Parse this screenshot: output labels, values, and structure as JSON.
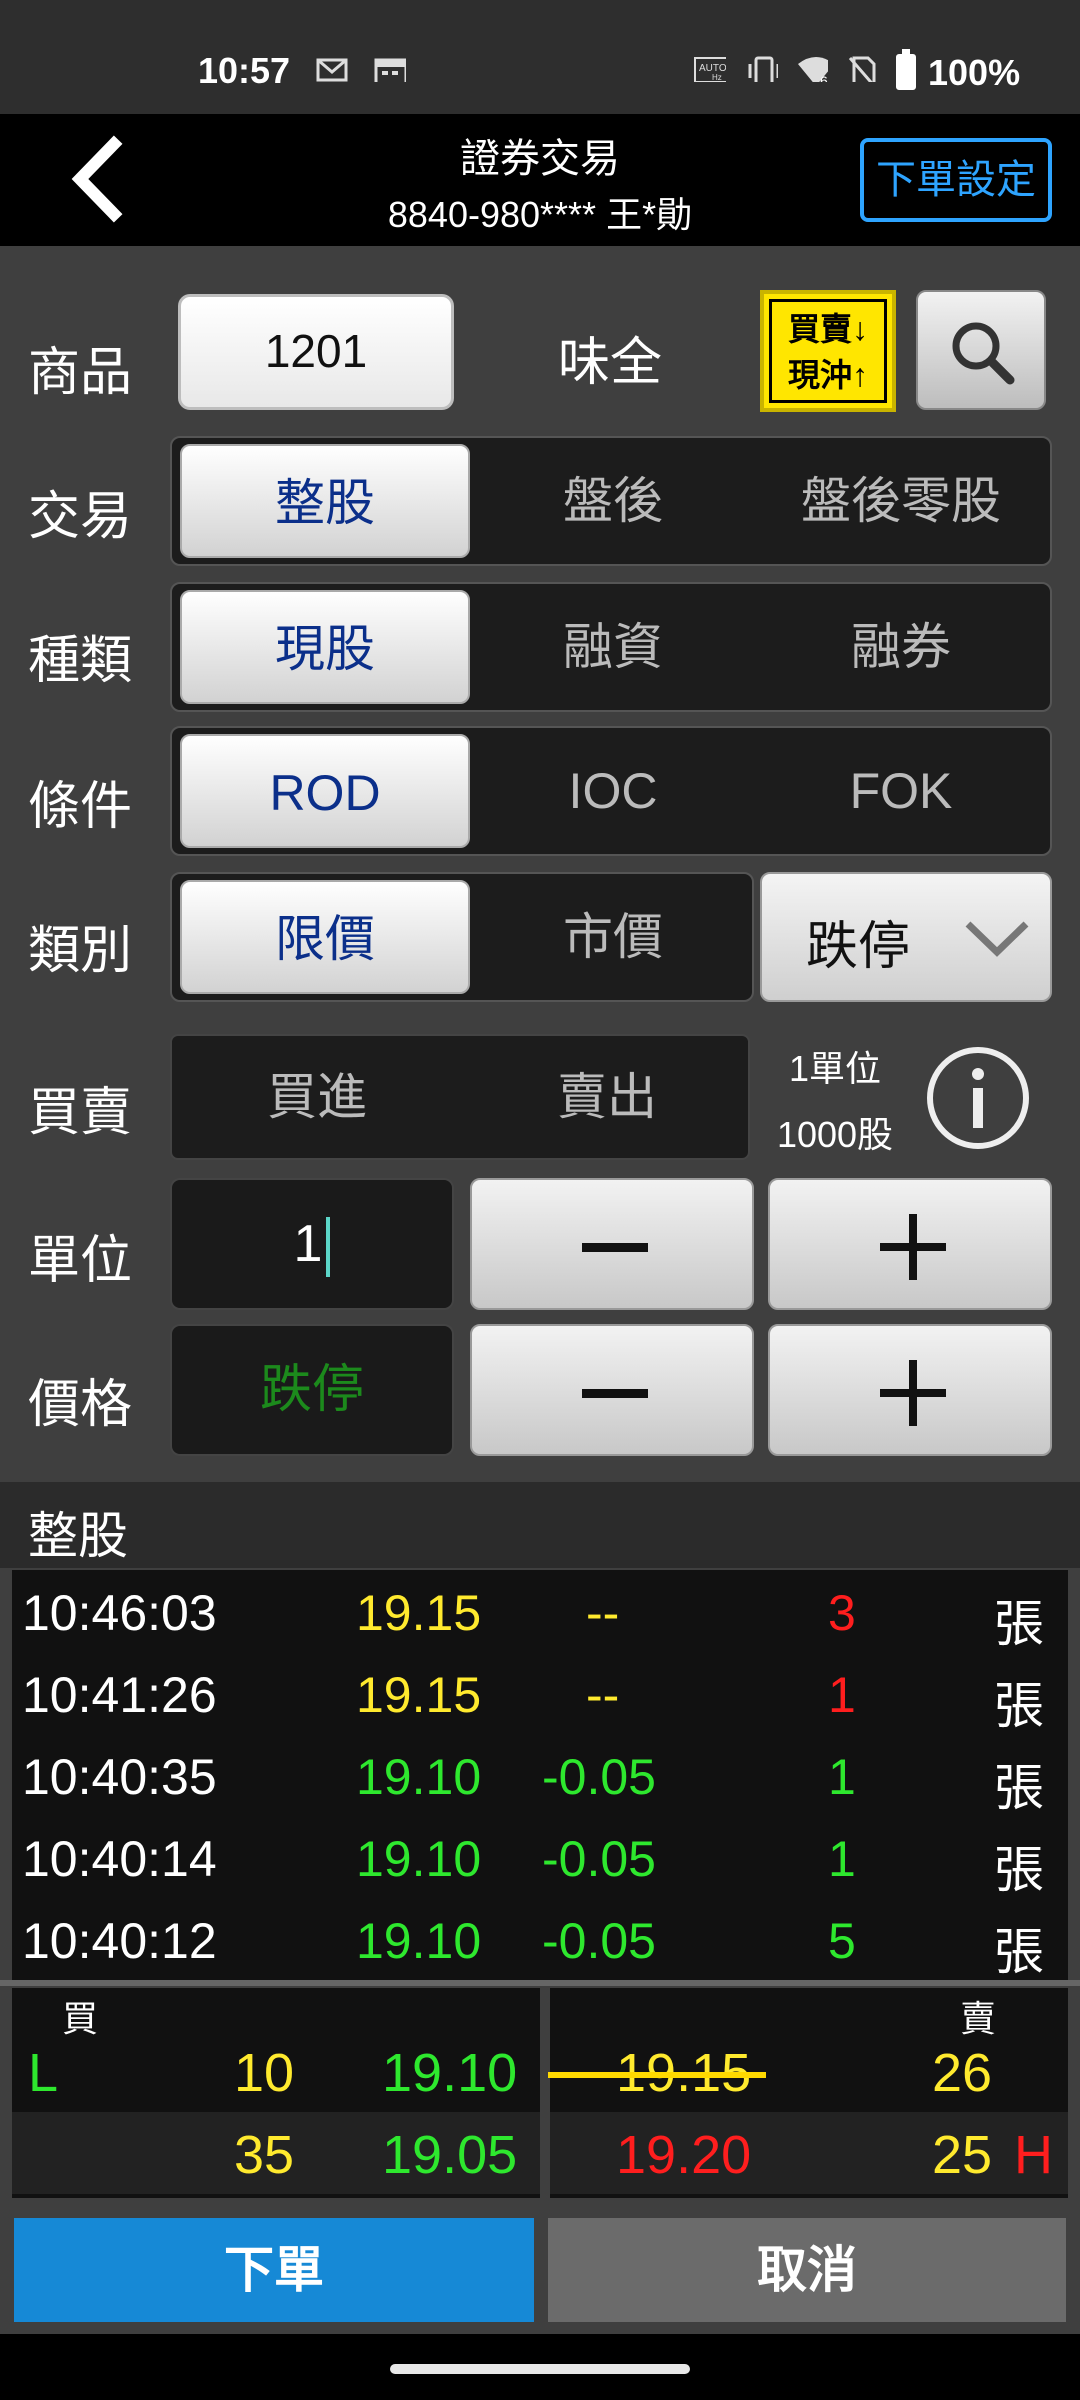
{
  "status_bar": {
    "time": "10:57",
    "battery": "100%",
    "icons": [
      "mail-icon",
      "calendar-icon",
      "auto-hz-icon",
      "vibrate-icon",
      "wifi-icon",
      "no-sim-icon",
      "battery-icon"
    ]
  },
  "header": {
    "title": "證券交易",
    "account": "8840-980**** 王*勛",
    "settings_label": "下單設定"
  },
  "labels": {
    "product": "商品",
    "trade": "交易",
    "kind": "種類",
    "condition": "條件",
    "category": "類別",
    "buy_sell": "買賣",
    "unit": "單位",
    "price": "價格"
  },
  "product": {
    "code": "1201",
    "name": "味全",
    "hedge_line1": "買賣↓",
    "hedge_line2": "現沖↑"
  },
  "trade_options": [
    "整股",
    "盤後",
    "盤後零股"
  ],
  "kind_options": [
    "現股",
    "融資",
    "融券"
  ],
  "condition_options": [
    "ROD",
    "IOC",
    "FOK"
  ],
  "category_options": [
    "限價",
    "市價"
  ],
  "price_type": "跌停",
  "buy_sell_options": [
    "買進",
    "賣出"
  ],
  "unit_info": {
    "line1": "1單位",
    "line2": "1000股"
  },
  "unit_value": "1",
  "price_value": "跌停",
  "section_title": "整股",
  "trades": [
    {
      "time": "10:46:03",
      "price": "19.15",
      "change": "--",
      "qty": "3",
      "unit": "張",
      "price_color": "#ffea2e",
      "change_color": "#ffea2e",
      "qty_color": "#ff1e1e"
    },
    {
      "time": "10:41:26",
      "price": "19.15",
      "change": "--",
      "qty": "1",
      "unit": "張",
      "price_color": "#ffea2e",
      "change_color": "#ffea2e",
      "qty_color": "#ff1e1e"
    },
    {
      "time": "10:40:35",
      "price": "19.10",
      "change": "-0.05",
      "qty": "1",
      "unit": "張",
      "price_color": "#2ee82e",
      "change_color": "#2ee82e",
      "qty_color": "#2ee82e"
    },
    {
      "time": "10:40:14",
      "price": "19.10",
      "change": "-0.05",
      "qty": "1",
      "unit": "張",
      "price_color": "#2ee82e",
      "change_color": "#2ee82e",
      "qty_color": "#2ee82e"
    },
    {
      "time": "10:40:12",
      "price": "19.10",
      "change": "-0.05",
      "qty": "5",
      "unit": "張",
      "price_color": "#2ee82e",
      "change_color": "#2ee82e",
      "qty_color": "#2ee82e"
    }
  ],
  "book": {
    "buy_label": "買",
    "sell_label": "賣",
    "rows": [
      {
        "flag_left": "L",
        "bid_qty": "10",
        "bid_price": "19.10",
        "ask_price": "19.15",
        "ask_qty": "26",
        "flag_right": "",
        "ask_price_color": "#ffea2e"
      },
      {
        "flag_left": "",
        "bid_qty": "35",
        "bid_price": "19.05",
        "ask_price": "19.20",
        "ask_qty": "25",
        "flag_right": "H",
        "ask_price_color": "#ff1e1e"
      }
    ]
  },
  "actions": {
    "order": "下單",
    "cancel": "取消"
  },
  "colors": {
    "accent_blue": "#1689d6",
    "active_text": "#0b2f8a",
    "up": "#ff1e1e",
    "down": "#2ee82e",
    "flat": "#ffea2e"
  }
}
